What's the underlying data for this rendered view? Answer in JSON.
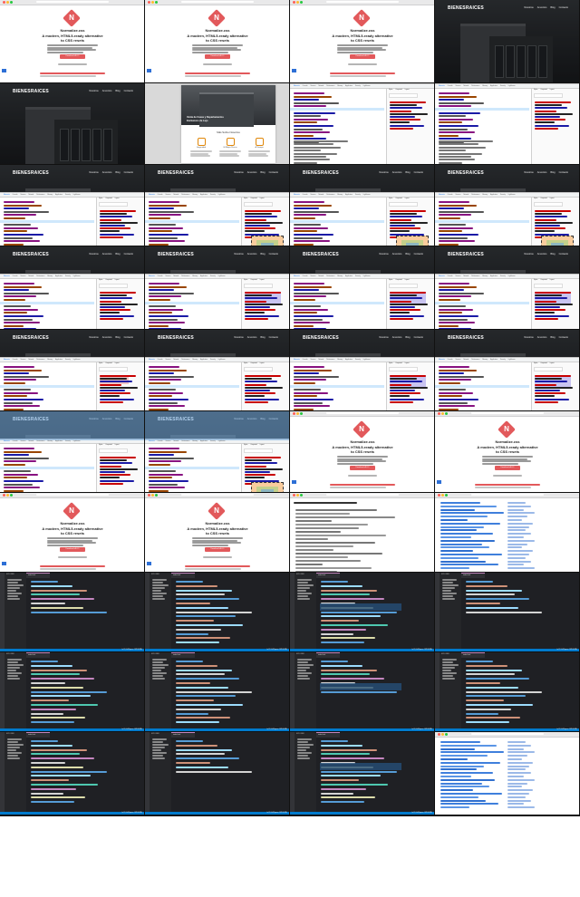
{
  "page": {
    "title": "Screen recording contact sheet"
  },
  "normalize": {
    "logo_glyph": "N",
    "brand": "Normalize.css",
    "tagline_line1": "A modern, HTML5-ready alternative",
    "tagline_line2": "to CSS resets",
    "download_label": "Download v8.0.1",
    "footer_line": "Normalize.css makes browsers render all elements more consistently and in line with modern standards."
  },
  "bienes": {
    "logo_part1": "BIENES",
    "logo_part2": "RAICES",
    "nav": [
      "Nosotros",
      "Anuncios",
      "Blog",
      "Contacto"
    ],
    "hero_line1": "Venta de Casas y Departamentos",
    "hero_line2": "Exclusivos de Lujo",
    "features_title": "Más Sobre Nosotros",
    "features": [
      "Seguridad",
      "El Mejor Precio",
      "A Tiempo"
    ]
  },
  "devtools": {
    "tabs": [
      "Elements",
      "Console",
      "Sources",
      "Network",
      "Performance",
      "Memory",
      "Application",
      "Security",
      "Lighthouse"
    ],
    "side_tabs": [
      "Styles",
      "Computed",
      "Layout"
    ],
    "filter_placeholder": "Filter"
  },
  "editor": {
    "tab_label": "index.html",
    "sidebar_title": "EXPLORER",
    "status": "Ln 12, Col 8   Spaces: 4   UTF-8   HTML"
  },
  "colors": {
    "normalize_accent": "#e2595b",
    "bienes_dark": "#2b2f33",
    "bienes_accent": "#e08709",
    "devtools_selection": "#cfe8fc",
    "editor_bg": "#1f2024",
    "editor_sidebar": "#252629",
    "editor_status": "#007acc"
  }
}
